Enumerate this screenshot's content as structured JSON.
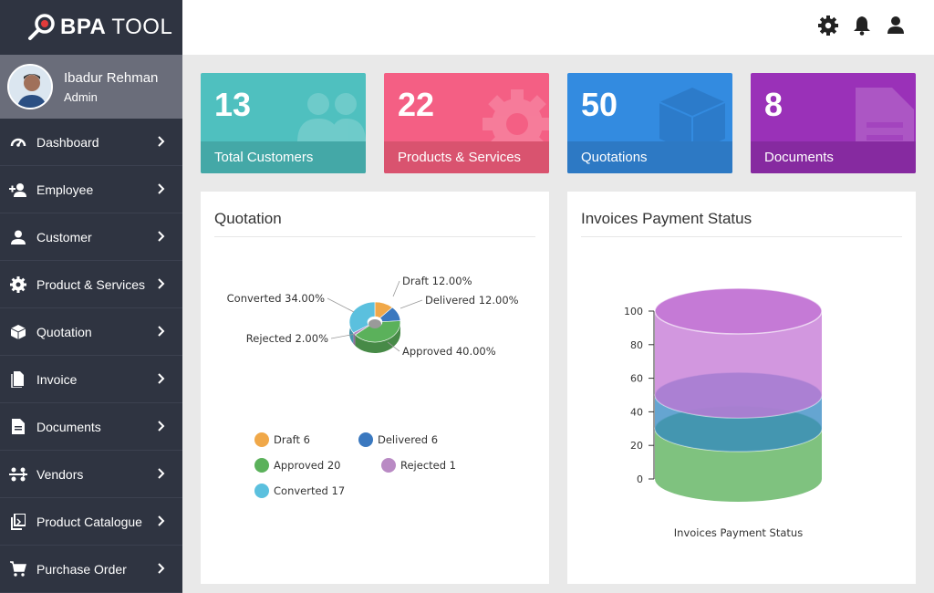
{
  "brand": {
    "bold": "BPA",
    "light": "TOOL"
  },
  "user": {
    "name": "Ibadur Rehman",
    "role": "Admin"
  },
  "menu": [
    {
      "label": "Dashboard",
      "icon": "dashboard-icon"
    },
    {
      "label": "Employee",
      "icon": "add-user-icon"
    },
    {
      "label": "Customer",
      "icon": "user-icon"
    },
    {
      "label": "Product & Services",
      "icon": "gear-icon"
    },
    {
      "label": "Quotation",
      "icon": "cube-icon"
    },
    {
      "label": "Invoice",
      "icon": "file-icon"
    },
    {
      "label": "Documents",
      "icon": "document-icon"
    },
    {
      "label": "Vendors",
      "icon": "vendors-icon"
    },
    {
      "label": "Product Catalogue",
      "icon": "catalogue-icon"
    },
    {
      "label": "Purchase Order",
      "icon": "cart-icon"
    }
  ],
  "topbar": {
    "icons": [
      "gear-icon",
      "bell-icon",
      "user-icon"
    ]
  },
  "cards": [
    {
      "value": "13",
      "label": "Total Customers",
      "color": "#4fc0bf",
      "foot": "#44a8a7"
    },
    {
      "value": "22",
      "label": "Products & Services",
      "color": "#f45f84",
      "foot": "#d9536f"
    },
    {
      "value": "50",
      "label": "Quotations",
      "color": "#338be0",
      "foot": "#2d79c4"
    },
    {
      "value": "8",
      "label": "Documents",
      "color": "#9a31b8",
      "foot": "#862aa0"
    }
  ],
  "panels": {
    "quotation": {
      "title": "Quotation"
    },
    "invoices": {
      "title": "Invoices Payment Status"
    }
  },
  "chart_data": [
    {
      "type": "pie",
      "title": "",
      "slices": [
        {
          "name": "Draft",
          "value": 6,
          "percent": "12.00%",
          "color": "#f0a849"
        },
        {
          "name": "Delivered",
          "value": 6,
          "percent": "12.00%",
          "color": "#3a78bf"
        },
        {
          "name": "Approved",
          "value": 20,
          "percent": "40.00%",
          "color": "#5bb15b"
        },
        {
          "name": "Rejected",
          "value": 1,
          "percent": "2.00%",
          "color": "#b98ac4"
        },
        {
          "name": "Converted",
          "value": 17,
          "percent": "34.00%",
          "color": "#5bc0de"
        }
      ],
      "legend_placement": "bottom"
    },
    {
      "type": "bar",
      "title": "Invoices Payment Status",
      "xlabel": "Invoices Payment Status",
      "ylim": [
        0,
        100
      ],
      "yticks": [
        "0",
        "20",
        "40",
        "60",
        "80",
        "100"
      ],
      "series": [
        {
          "value": 30,
          "color": "#5bb15b"
        },
        {
          "value": 50,
          "color": "#3a8cc4"
        },
        {
          "value": 100,
          "color": "#c57ad6"
        }
      ]
    }
  ]
}
